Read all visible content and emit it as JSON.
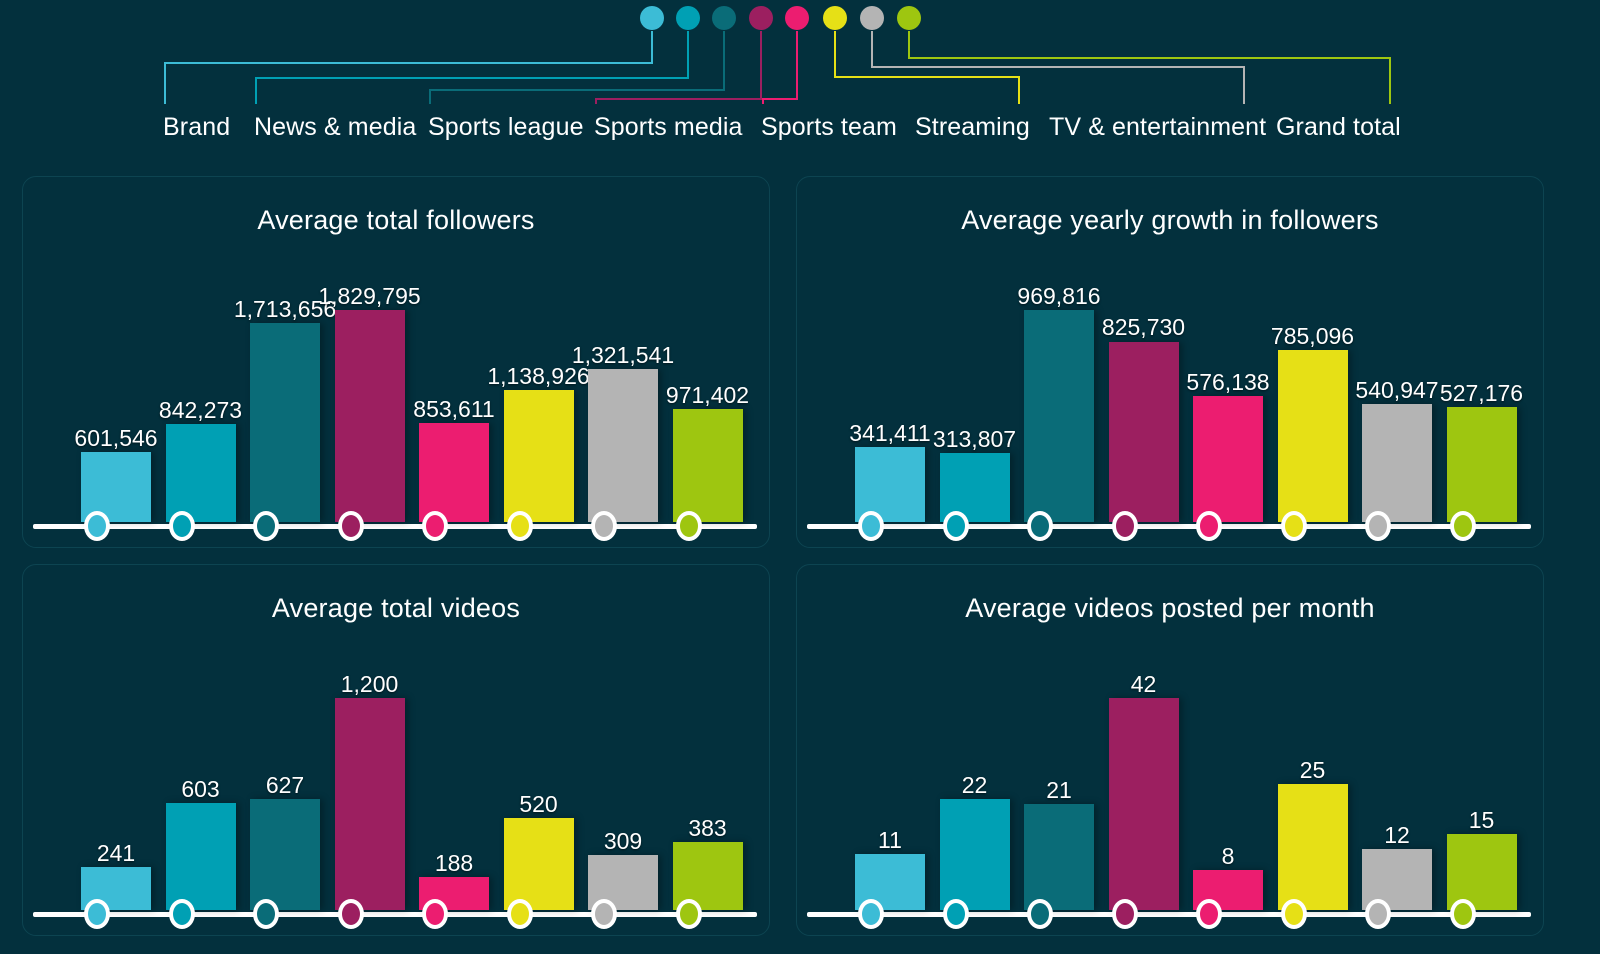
{
  "palette": {
    "background": "#03303d",
    "panel_border": "#0d4451",
    "axis": "#ffffff",
    "label_text": "#ffffff"
  },
  "legend": {
    "items": [
      {
        "label": "Brand",
        "color": "#3cbcd6"
      },
      {
        "label": "News & media",
        "color": "#00a0b4"
      },
      {
        "label": "Sports league",
        "color": "#0a6c78"
      },
      {
        "label": "Sports media",
        "color": "#9c1f60"
      },
      {
        "label": "Sports team",
        "color": "#ec1d70"
      },
      {
        "label": "Streaming",
        "color": "#e6e016"
      },
      {
        "label": "TV & entertainment",
        "color": "#b4b4b4"
      },
      {
        "label": "Grand total",
        "color": "#9ec610"
      }
    ]
  },
  "chart_data": [
    {
      "type": "bar",
      "title": "Average total followers",
      "xlabel": "",
      "ylabel": "",
      "grid": false,
      "legend_position": "top",
      "ylim": [
        0,
        1829795
      ],
      "categories": [
        "Brand",
        "News & media",
        "Sports league",
        "Sports media",
        "Sports team",
        "Streaming",
        "TV & entertainment",
        "Grand total"
      ],
      "values": [
        601546,
        842273,
        1713656,
        1829795,
        853611,
        1138926,
        1321541,
        971402
      ],
      "labels": [
        "601,546",
        "842,273",
        "1,713,656",
        "1,829,795",
        "853,611",
        "1,138,926",
        "1,321,541",
        "971,402"
      ]
    },
    {
      "type": "bar",
      "title": "Average yearly growth in followers",
      "xlabel": "",
      "ylabel": "",
      "grid": false,
      "legend_position": "top",
      "ylim": [
        0,
        969816
      ],
      "categories": [
        "Brand",
        "News & media",
        "Sports league",
        "Sports media",
        "Sports team",
        "Streaming",
        "TV & entertainment",
        "Grand total"
      ],
      "values": [
        341411,
        313807,
        969816,
        825730,
        576138,
        785096,
        540947,
        527176
      ],
      "labels": [
        "341,411",
        "313,807",
        "969,816",
        "825,730",
        "576,138",
        "785,096",
        "540,947",
        "527,176"
      ]
    },
    {
      "type": "bar",
      "title": "Average total videos",
      "xlabel": "",
      "ylabel": "",
      "grid": false,
      "legend_position": "top",
      "ylim": [
        0,
        1200
      ],
      "categories": [
        "Brand",
        "News & media",
        "Sports league",
        "Sports media",
        "Sports team",
        "Streaming",
        "TV & entertainment",
        "Grand total"
      ],
      "values": [
        241,
        603,
        627,
        1200,
        188,
        520,
        309,
        383
      ],
      "labels": [
        "241",
        "603",
        "627",
        "1,200",
        "188",
        "520",
        "309",
        "383"
      ]
    },
    {
      "type": "bar",
      "title": "Average videos posted per month",
      "xlabel": "",
      "ylabel": "",
      "grid": false,
      "legend_position": "top",
      "ylim": [
        0,
        42
      ],
      "categories": [
        "Brand",
        "News & media",
        "Sports league",
        "Sports media",
        "Sports team",
        "Streaming",
        "TV & entertainment",
        "Grand total"
      ],
      "values": [
        11,
        22,
        21,
        42,
        8,
        25,
        12,
        15
      ],
      "labels": [
        "11",
        "22",
        "21",
        "42",
        "8",
        "25",
        "12",
        "15"
      ]
    }
  ]
}
